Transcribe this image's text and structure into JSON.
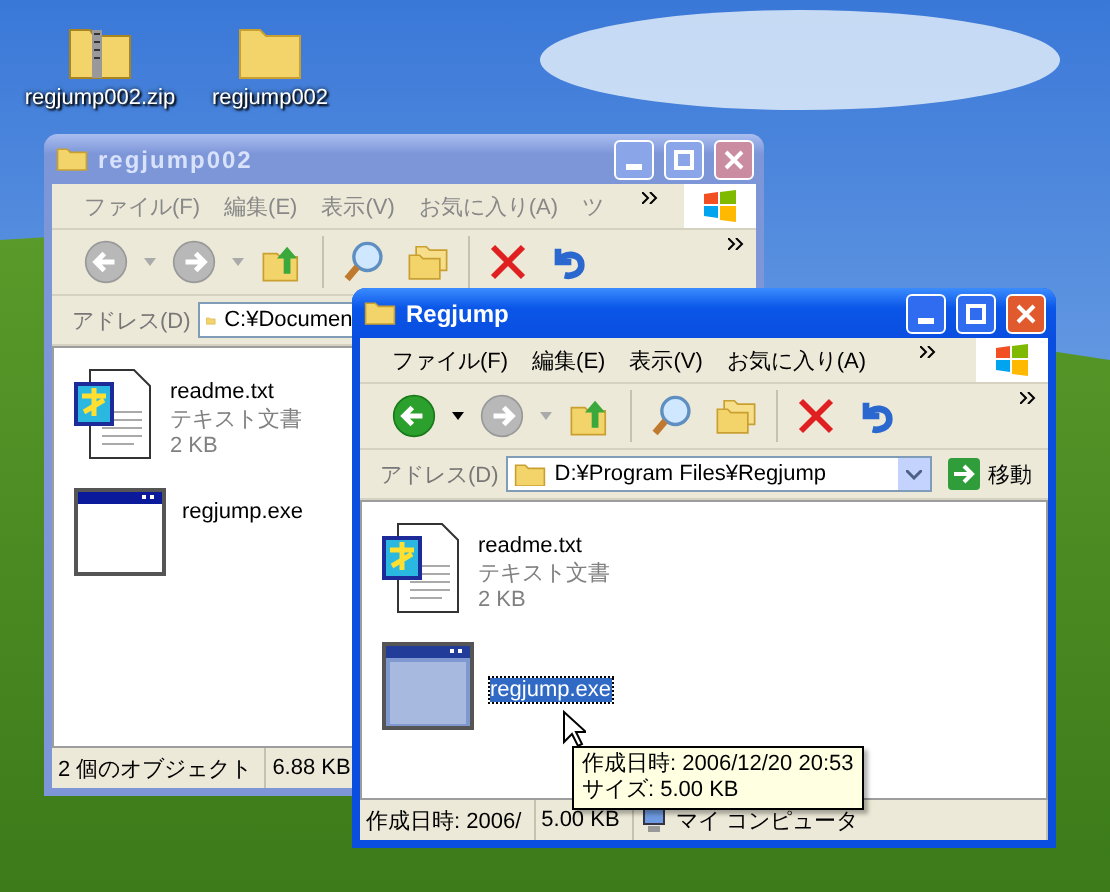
{
  "desktop_icons": [
    {
      "label": "regjump002.zip",
      "kind": "zip"
    },
    {
      "label": "regjump002",
      "kind": "folder"
    }
  ],
  "windows": [
    {
      "title": "regjump002",
      "active": false,
      "menu": [
        "ファイル(F)",
        "編集(E)",
        "表示(V)",
        "お気に入り(A)",
        "ツ"
      ],
      "toolbar": [
        {
          "kind": "back",
          "disabled": true
        },
        {
          "kind": "forward",
          "disabled": true
        },
        {
          "kind": "up",
          "disabled": false
        },
        {
          "kind": "search",
          "disabled": false
        },
        {
          "kind": "folders",
          "disabled": false
        },
        {
          "kind": "delete",
          "disabled": false
        },
        {
          "kind": "undo",
          "disabled": false
        }
      ],
      "address": {
        "label": "アドレス(D)",
        "path": "C:¥Documen"
      },
      "files": [
        {
          "kind": "text",
          "name": "readme.txt",
          "type": "テキスト文書",
          "size": "2 KB",
          "selected": false
        },
        {
          "kind": "program",
          "name": "regjump.exe",
          "selected": false
        }
      ],
      "status": [
        {
          "kind": "text",
          "text": "2 個のオブジェクト"
        },
        {
          "kind": "text",
          "text": "6.88 KB"
        }
      ]
    },
    {
      "title": "Regjump",
      "active": true,
      "menu": [
        "ファイル(F)",
        "編集(E)",
        "表示(V)",
        "お気に入り(A)"
      ],
      "toolbar": [
        {
          "kind": "back",
          "disabled": false
        },
        {
          "kind": "forward",
          "disabled": true
        },
        {
          "kind": "up",
          "disabled": false
        },
        {
          "kind": "search",
          "disabled": false
        },
        {
          "kind": "folders",
          "disabled": false
        },
        {
          "kind": "delete",
          "disabled": false
        },
        {
          "kind": "undo",
          "disabled": false
        }
      ],
      "address": {
        "label": "アドレス(D)",
        "path": "D:¥Program Files¥Regjump",
        "go": "移動"
      },
      "files": [
        {
          "kind": "text",
          "name": "readme.txt",
          "type": "テキスト文書",
          "size": "2 KB",
          "selected": false
        },
        {
          "kind": "program",
          "name": "regjump.exe",
          "selected": true
        }
      ],
      "tooltip": [
        "作成日時: 2006/12/20 20:53",
        "サイズ: 5.00 KB"
      ],
      "status": [
        {
          "kind": "text",
          "text": "作成日時: 2006/"
        },
        {
          "kind": "text",
          "text": "5.00 KB"
        },
        {
          "kind": "computer",
          "text": "マイ コンピュータ"
        }
      ]
    }
  ]
}
